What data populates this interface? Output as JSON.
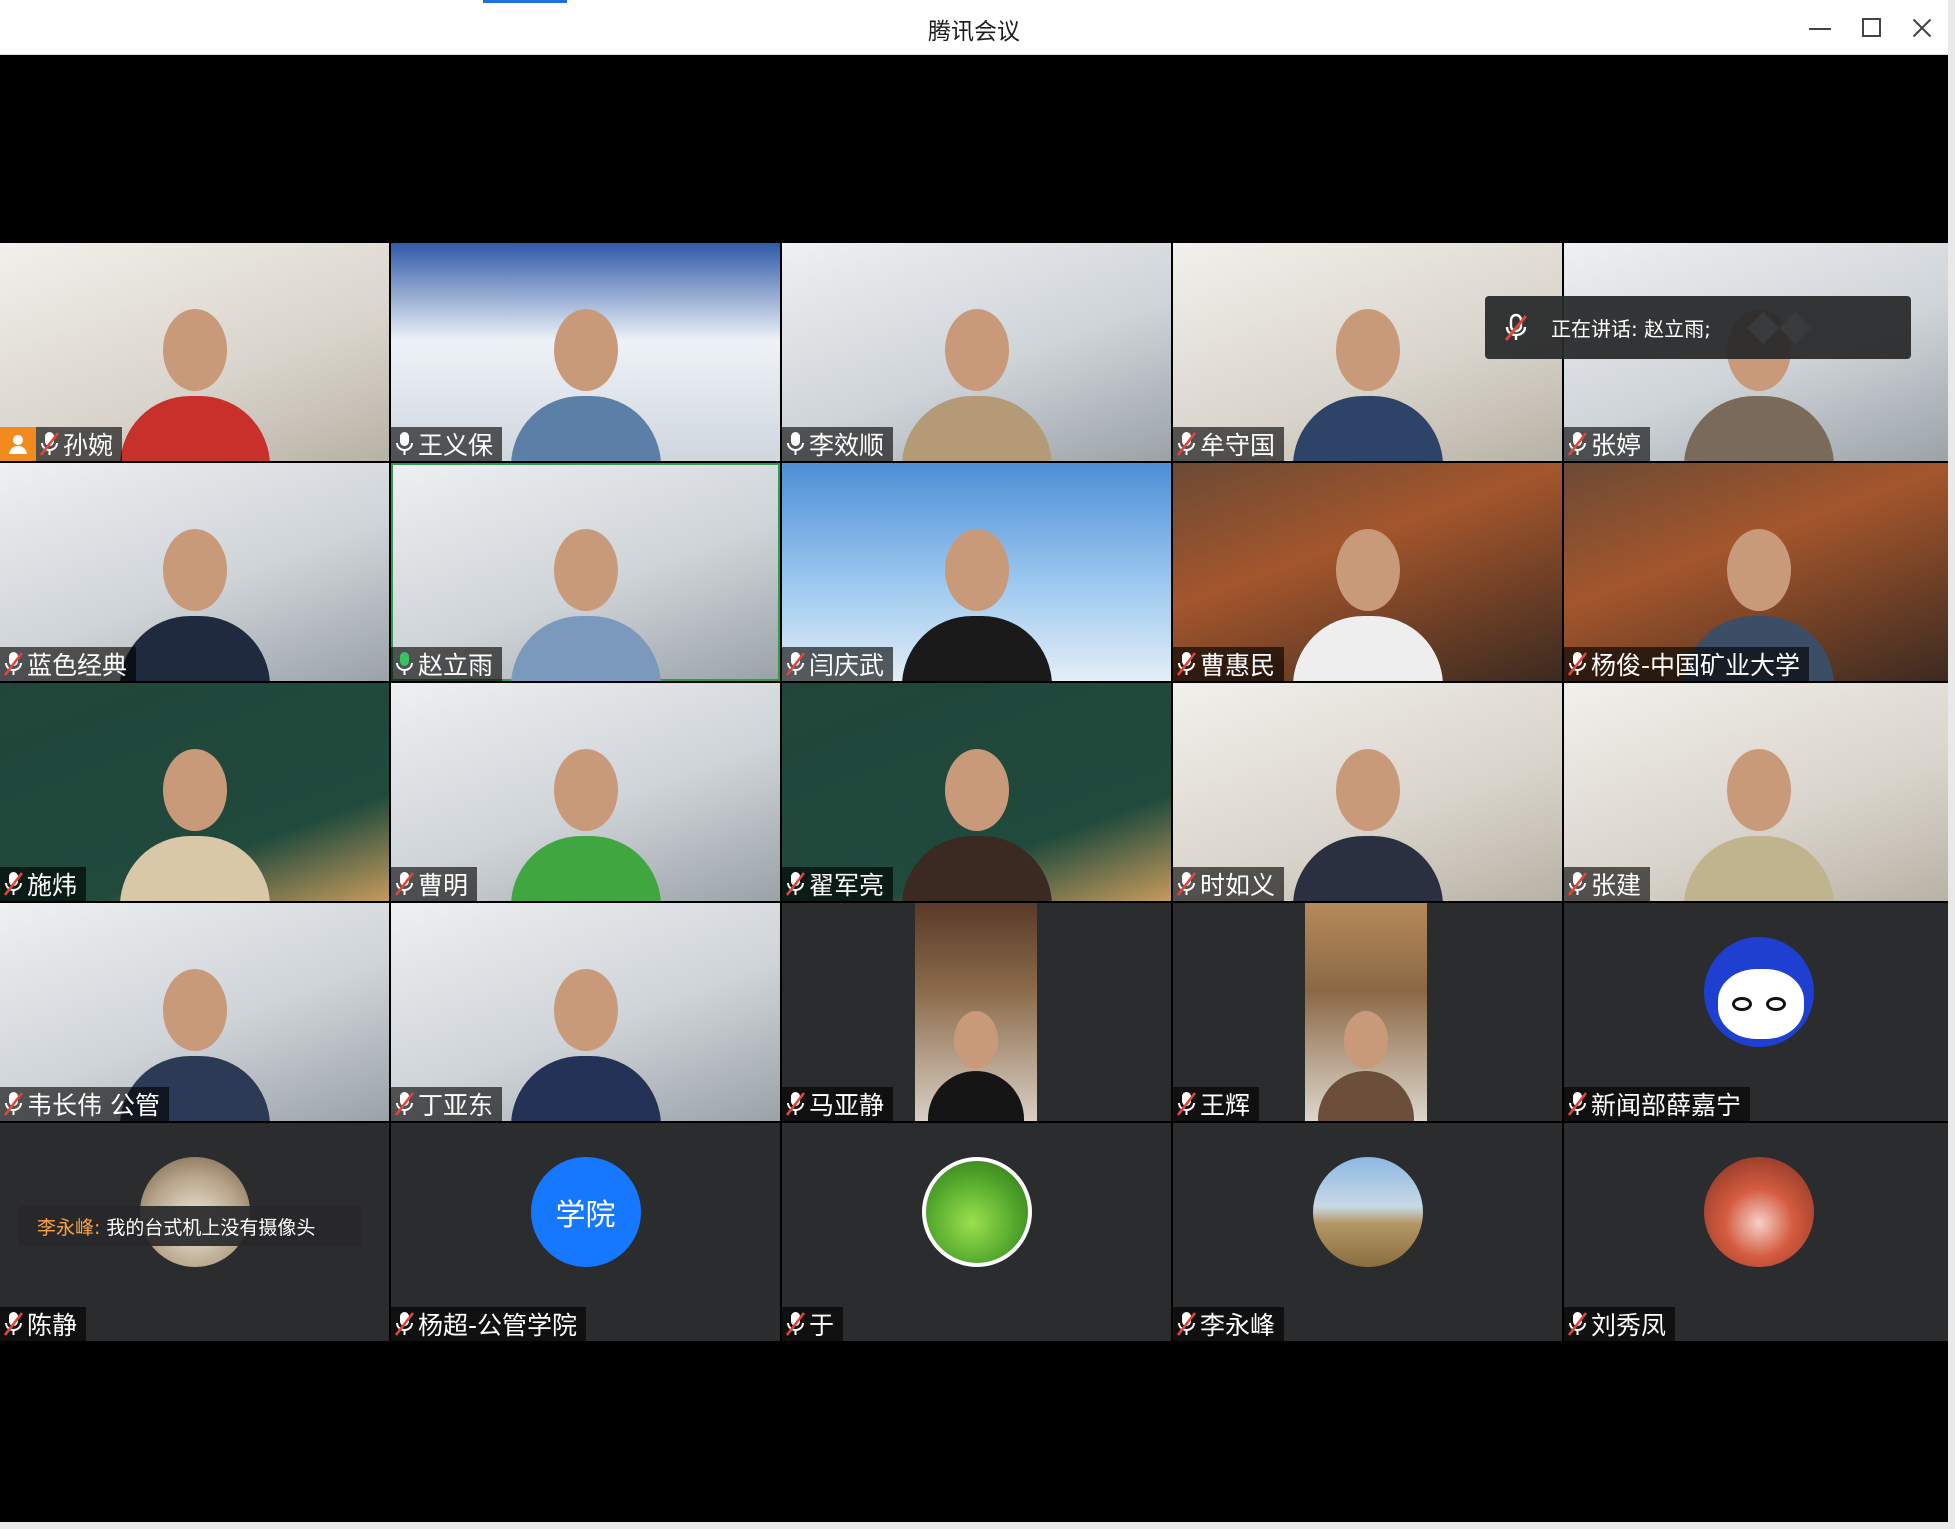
{
  "window": {
    "title": "腾讯会议"
  },
  "speaking": {
    "text": "正在讲话: 赵立雨;"
  },
  "chat": {
    "sender": "李永峰:",
    "message": "我的台式机上没有摄像头"
  },
  "colors": {
    "accent": "#1e6fe0",
    "active_border": "#2e9d52",
    "host_badge": "#f28b1e",
    "avatar_text_bg": "#1677ff",
    "chat_sender": "#f4a24a"
  },
  "participants": [
    {
      "name": "孙婉",
      "mic": "muted",
      "host": true
    },
    {
      "name": "王义保",
      "mic": "on"
    },
    {
      "name": "李效顺",
      "mic": "on"
    },
    {
      "name": "牟守国",
      "mic": "muted"
    },
    {
      "name": "张婷",
      "mic": "muted"
    },
    {
      "name": "蓝色经典",
      "mic": "muted"
    },
    {
      "name": "赵立雨",
      "mic": "speaking",
      "active": true
    },
    {
      "name": "闫庆武",
      "mic": "muted"
    },
    {
      "name": "曹惠民",
      "mic": "muted"
    },
    {
      "name": "杨俊-中国矿业大学",
      "mic": "muted"
    },
    {
      "name": "施炜",
      "mic": "muted"
    },
    {
      "name": "曹明",
      "mic": "muted"
    },
    {
      "name": "翟军亮",
      "mic": "muted"
    },
    {
      "name": "时如义",
      "mic": "muted"
    },
    {
      "name": "张建",
      "mic": "muted"
    },
    {
      "name": "韦长伟 公管",
      "mic": "muted"
    },
    {
      "name": "丁亚东",
      "mic": "muted"
    },
    {
      "name": "马亚静",
      "mic": "muted"
    },
    {
      "name": "王辉",
      "mic": "muted"
    },
    {
      "name": "新闻部薛嘉宁",
      "mic": "muted",
      "avatar": "cartoon-avatar"
    },
    {
      "name": "陈静",
      "mic": "muted",
      "avatar": "plant-avatar"
    },
    {
      "name": "杨超-公管学院",
      "mic": "muted",
      "avatar_text": "学院"
    },
    {
      "name": "于",
      "mic": "muted",
      "avatar": "apple-avatar"
    },
    {
      "name": "李永峰",
      "mic": "muted",
      "avatar": "tree-avatar"
    },
    {
      "name": "刘秀凤",
      "mic": "muted",
      "avatar": "flower-avatar"
    }
  ]
}
